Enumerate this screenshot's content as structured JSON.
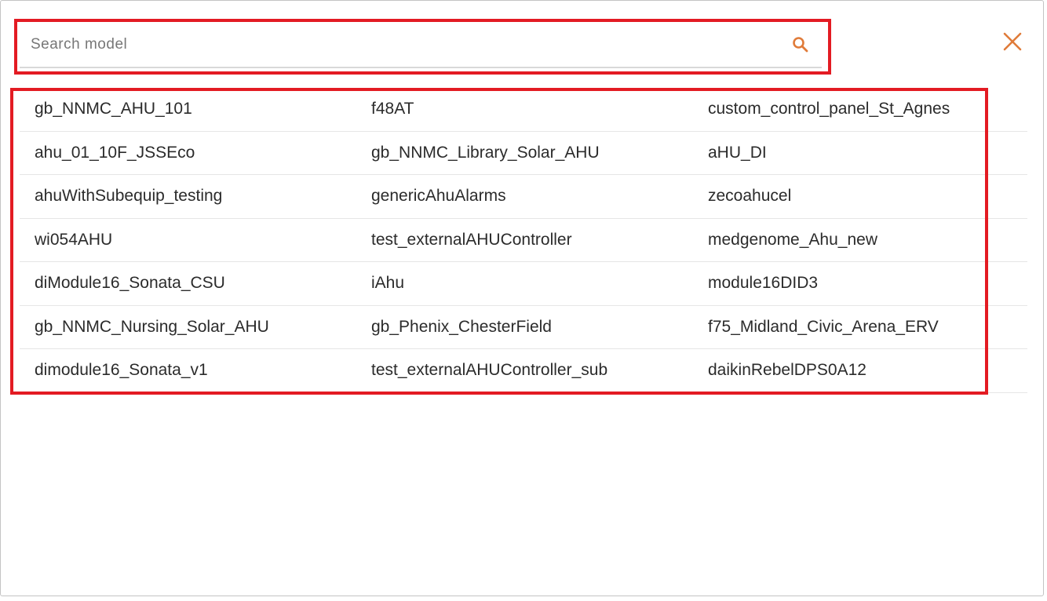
{
  "search": {
    "placeholder": "Search model",
    "value": ""
  },
  "icons": {
    "search": "search-icon",
    "close": "close-icon"
  },
  "colors": {
    "accent": "#e07b39",
    "highlight": "#e31b23",
    "divider": "#e6e6e6",
    "text": "#2b2b2b"
  },
  "models": [
    [
      "gb_NNMC_AHU_101",
      "f48AT",
      "custom_control_panel_St_Agnes"
    ],
    [
      "ahu_01_10F_JSSEco",
      "gb_NNMC_Library_Solar_AHU",
      "aHU_DI"
    ],
    [
      "ahuWithSubequip_testing",
      "genericAhuAlarms",
      "zecoahucel"
    ],
    [
      "wi054AHU",
      "test_externalAHUController",
      "medgenome_Ahu_new"
    ],
    [
      "diModule16_Sonata_CSU",
      "iAhu",
      "module16DID3"
    ],
    [
      "gb_NNMC_Nursing_Solar_AHU",
      "gb_Phenix_ChesterField",
      "f75_Midland_Civic_Arena_ERV"
    ],
    [
      "dimodule16_Sonata_v1",
      "test_externalAHUController_sub",
      "daikinRebelDPS0A12"
    ]
  ]
}
